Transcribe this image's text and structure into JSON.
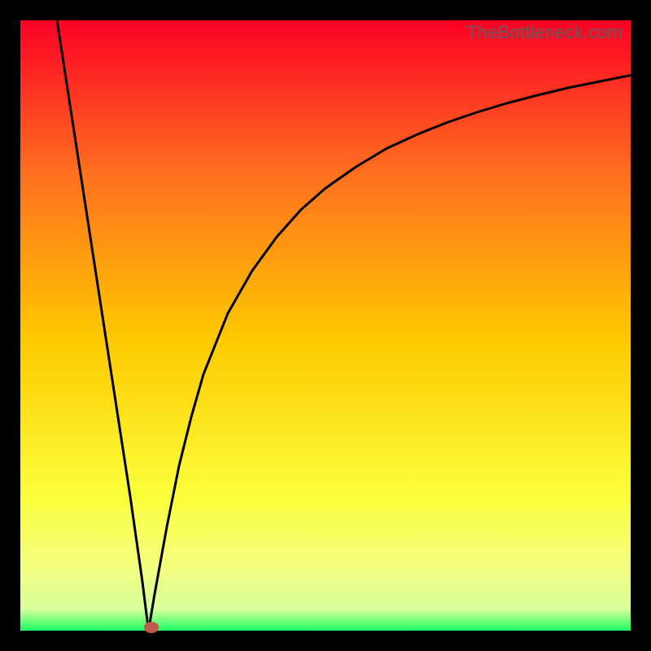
{
  "watermark": "TheBottleneck.com",
  "colors": {
    "top": "#fd0025",
    "mid_upper": "#ff6f1f",
    "mid": "#fec800",
    "mid_lower": "#fbff3a",
    "band": "#f3ff83",
    "bottom": "#1aff62",
    "black": "#000000",
    "curve": "#000000",
    "marker": "#c05a4f"
  },
  "chart_data": {
    "type": "line",
    "title": "",
    "xlabel": "",
    "ylabel": "",
    "x_range": [
      0,
      100
    ],
    "y_range": [
      0,
      100
    ],
    "description": "Bottleneck-style V curve with minimum near x≈21; left segment near-linear descending from (6,100) to (21,0); right segment monotonically rising and flattening toward (100,≈91).",
    "series": [
      {
        "name": "curve",
        "x": [
          6,
          8,
          10,
          12,
          14,
          16,
          18,
          20,
          21,
          22,
          24,
          26,
          28,
          30,
          34,
          38,
          42,
          46,
          50,
          55,
          60,
          65,
          70,
          75,
          80,
          85,
          90,
          95,
          100
        ],
        "y": [
          100,
          87,
          74,
          61,
          48,
          35,
          22,
          8,
          0,
          6,
          17,
          27,
          35,
          42,
          52,
          59,
          64.5,
          69,
          72.5,
          76,
          79,
          81.3,
          83.3,
          85,
          86.5,
          87.8,
          89,
          90,
          91
        ]
      }
    ],
    "marker": {
      "x": 21.5,
      "y": 0.5
    },
    "gradient_stops": [
      {
        "offset": 0.0,
        "color": "#fd0025"
      },
      {
        "offset": 0.25,
        "color": "#ff6f1f"
      },
      {
        "offset": 0.52,
        "color": "#fec800"
      },
      {
        "offset": 0.78,
        "color": "#fbff3a"
      },
      {
        "offset": 0.9,
        "color": "#f3ff83"
      },
      {
        "offset": 0.965,
        "color": "#d7ff9b"
      },
      {
        "offset": 1.0,
        "color": "#1aff62"
      }
    ]
  }
}
